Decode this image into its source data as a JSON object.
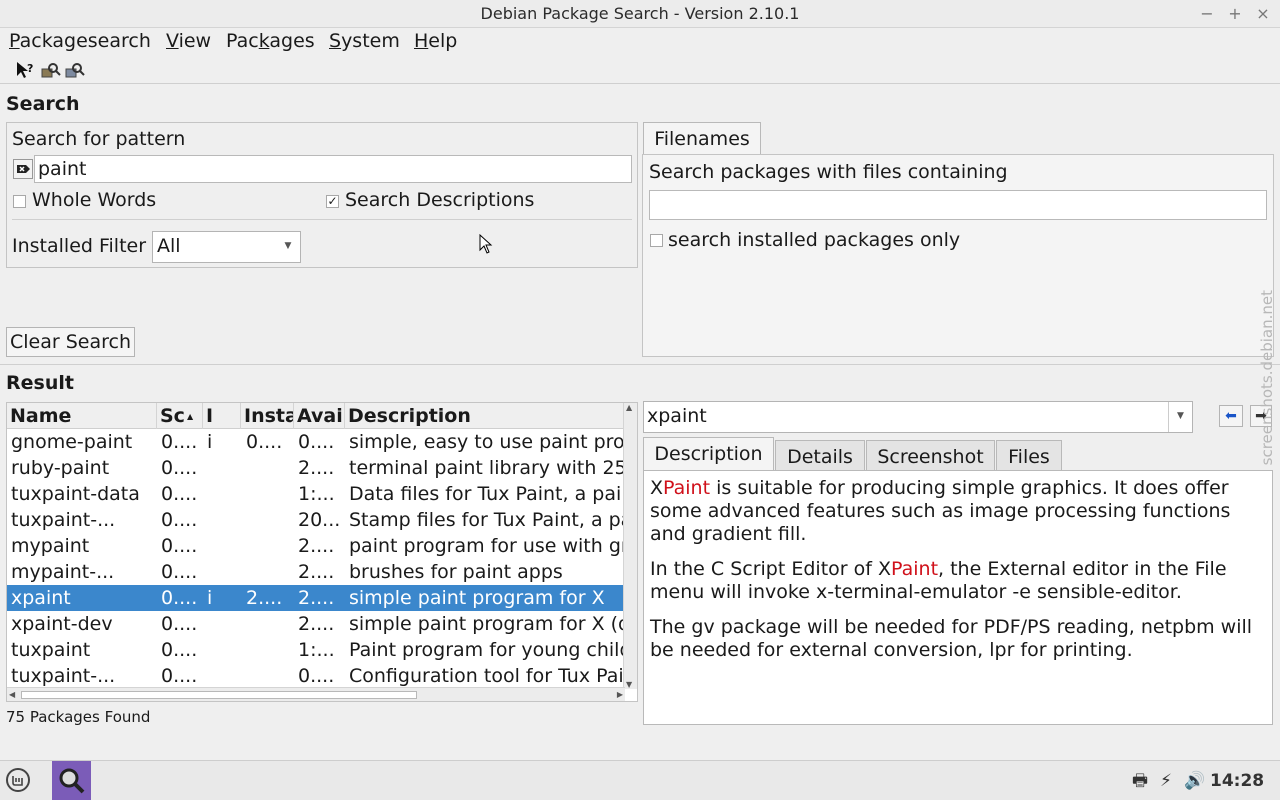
{
  "window": {
    "title": "Debian Package Search - Version 2.10.1"
  },
  "menu": {
    "items": [
      {
        "acc": "P",
        "rest": "ackagesearch"
      },
      {
        "acc": "V",
        "rest": "iew"
      },
      {
        "acc": "",
        "pre": "Pac",
        "acc2": "k",
        "rest": "ages"
      },
      {
        "acc": "S",
        "rest": "ystem"
      },
      {
        "acc": "H",
        "rest": "elp"
      }
    ]
  },
  "toolbar": {
    "icons": [
      "whats-this-icon",
      "search-package-icon",
      "search-package-alt-icon"
    ]
  },
  "search": {
    "section_label": "Search",
    "pattern_label": "Search for pattern",
    "pattern_value": "paint",
    "whole_words_label": "Whole Words",
    "whole_words_checked": false,
    "search_descriptions_label": "Search Descriptions",
    "search_descriptions_checked": true,
    "installed_filter_label": "Installed Filter",
    "installed_filter_value": "All",
    "clear_button": "Clear Search"
  },
  "filenames": {
    "tab_label": "Filenames",
    "prompt": "Search packages with files containing",
    "value": "",
    "installed_only_label": "search installed packages only",
    "installed_only_checked": false
  },
  "result": {
    "section_label": "Result",
    "columns": [
      "Name",
      "Sc",
      "I",
      "Insta",
      "Avail",
      "Description"
    ],
    "rows": [
      [
        "gnome-paint",
        "0....",
        "i",
        "0....",
        "0....",
        "simple, easy to use paint pro"
      ],
      [
        "ruby-paint",
        "0....",
        "",
        "",
        "2....",
        "terminal paint library with 25"
      ],
      [
        "tuxpaint-data",
        "0....",
        "",
        "",
        "1:...",
        "Data files for Tux Paint, a pai"
      ],
      [
        "tuxpaint-...",
        "0....",
        "",
        "",
        "20...",
        "Stamp files for Tux Paint, a pa"
      ],
      [
        "mypaint",
        "0....",
        "",
        "",
        "2....",
        "paint program for use with gr"
      ],
      [
        "mypaint-...",
        "0....",
        "",
        "",
        "2....",
        "brushes for paint apps"
      ],
      [
        "xpaint",
        "0....",
        "i",
        "2....",
        "2....",
        "simple paint program for X"
      ],
      [
        "xpaint-dev",
        "0....",
        "",
        "",
        "2....",
        "simple paint program for X (d"
      ],
      [
        "tuxpaint",
        "0....",
        "",
        "",
        "1:...",
        "Paint program for young child"
      ],
      [
        "tuxpaint-...",
        "0....",
        "",
        "",
        "0....",
        "Configuration tool for Tux Pai"
      ]
    ],
    "selected_index": 6,
    "status": "75 Packages Found"
  },
  "details": {
    "package": "xpaint",
    "tabs": [
      "Description",
      "Details",
      "Screenshot",
      "Files"
    ],
    "active_tab": "Description",
    "p1_a": "X",
    "p1_hl": "Paint",
    "p1_b": " is suitable for producing simple graphics. It does offer some advanced features such as image processing functions and gradient fill.",
    "p2_a": "In the C Script Editor of X",
    "p2_hl": "Paint",
    "p2_b": ", the External editor in the File menu will invoke x-terminal-emulator -e sensible-editor.",
    "p3": "The gv package will be needed for PDF/PS reading, netpbm will be needed for external conversion, lpr for printing."
  },
  "watermark": "screenshots.debian.net",
  "taskbar": {
    "clock": "14:28"
  },
  "colors": {
    "selection": "#3b87cc",
    "highlight": "#d0101a",
    "taskbar_app": "#7b5cb8"
  }
}
